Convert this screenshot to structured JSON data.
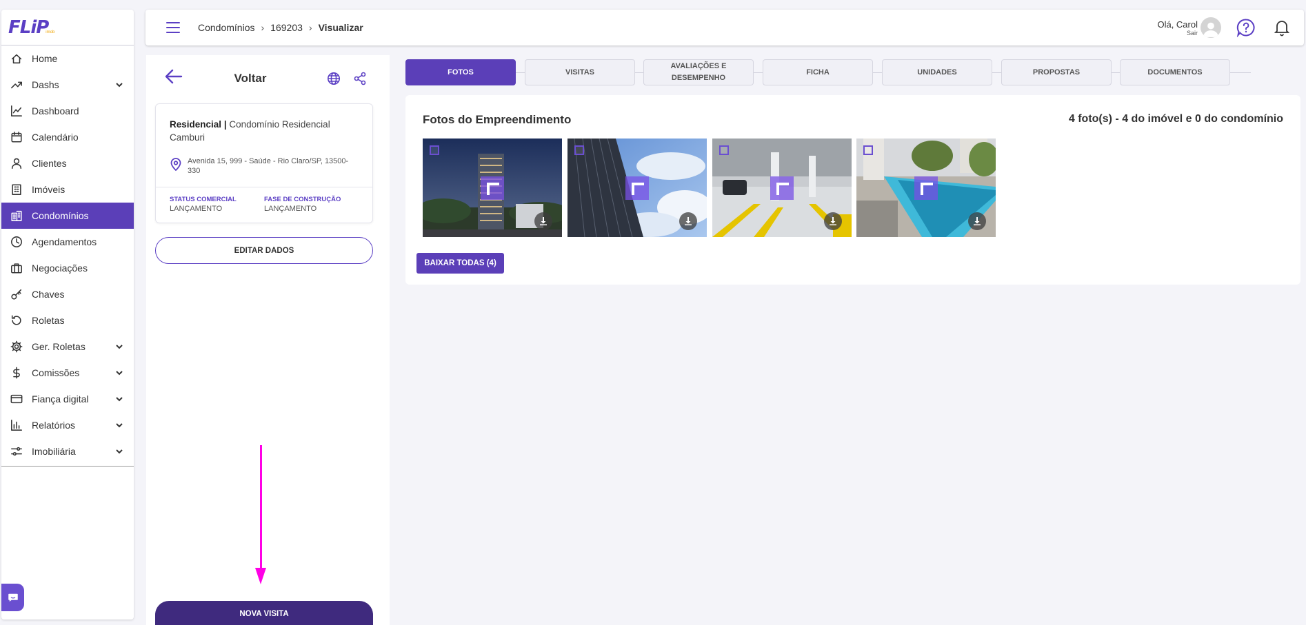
{
  "logo": {
    "text": "FLiP",
    "sub": "imob"
  },
  "sidebar": {
    "items": [
      {
        "label": "Home",
        "icon": "home-icon"
      },
      {
        "label": "Dashs",
        "icon": "trending-up-icon",
        "expandable": true
      },
      {
        "label": "Dashboard",
        "icon": "line-chart-icon"
      },
      {
        "label": "Calendário",
        "icon": "calendar-icon"
      },
      {
        "label": "Clientes",
        "icon": "user-icon"
      },
      {
        "label": "Imóveis",
        "icon": "building-icon"
      },
      {
        "label": "Condomínios",
        "icon": "buildings-icon",
        "active": true
      },
      {
        "label": "Agendamentos",
        "icon": "clock-icon"
      },
      {
        "label": "Negociações",
        "icon": "briefcase-icon"
      },
      {
        "label": "Chaves",
        "icon": "key-icon"
      },
      {
        "label": "Roletas",
        "icon": "rotate-icon"
      },
      {
        "label": "Ger. Roletas",
        "icon": "gear-icon",
        "expandable": true
      },
      {
        "label": "Comissões",
        "icon": "dollar-icon",
        "expandable": true
      },
      {
        "label": "Fiança digital",
        "icon": "credit-card-icon",
        "expandable": true
      },
      {
        "label": "Relatórios",
        "icon": "bar-chart-icon",
        "expandable": true
      },
      {
        "label": "Imobiliária",
        "icon": "sliders-icon",
        "expandable": true
      }
    ]
  },
  "header": {
    "breadcrumb": [
      "Condomínios",
      "169203",
      "Visualizar"
    ],
    "greeting": "Olá, Carol",
    "logout": "Sair"
  },
  "panel": {
    "title": "Voltar",
    "property_type": "Residencial",
    "property_name": "Condomínio Residencial Camburi",
    "address": "Avenida 15, 999 - Saúde - Rio Claro/SP, 13500-330",
    "status_label": "STATUS COMERCIAL",
    "status_value": "LANÇAMENTO",
    "phase_label": "FASE DE CONSTRUÇÃO",
    "phase_value": "LANÇAMENTO",
    "edit_button": "EDITAR DADOS",
    "new_visit_button": "NOVA VISITA"
  },
  "tabs": [
    {
      "label": "FOTOS",
      "active": true
    },
    {
      "label": "VISITAS"
    },
    {
      "label": "AVALIAÇÕES E DESEMPENHO"
    },
    {
      "label": "FICHA"
    },
    {
      "label": "UNIDADES"
    },
    {
      "label": "PROPOSTAS"
    },
    {
      "label": "DOCUMENTOS"
    }
  ],
  "photos": {
    "title": "Fotos do Empreendimento",
    "count": "4 foto(s) - 4 do imóvel e 0 do condomínio",
    "items": [
      {
        "scene": "tower-night"
      },
      {
        "scene": "tower-sky"
      },
      {
        "scene": "garage"
      },
      {
        "scene": "pool"
      }
    ],
    "download_all": "BAIXAR TODAS (4)"
  },
  "colors": {
    "accent": "#5b3fb8",
    "accent_dark": "#3f2a7e",
    "annotation": "#ff00e6"
  }
}
